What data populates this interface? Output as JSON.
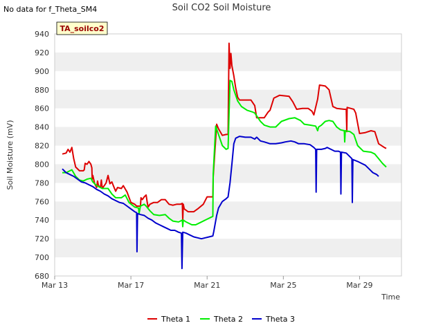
{
  "no_data_note": "No data for f_Theta_SM4",
  "site_tag": "TA_soilco2",
  "colors": {
    "theta1": "#dd0000",
    "theta2": "#00ee00",
    "theta3": "#0000cc",
    "band": "#efefef",
    "tag_bg": "#ffffcc"
  },
  "chart_data": {
    "type": "line",
    "title": "Soil CO2 Soil Moisture",
    "xlabel": "Time",
    "ylabel": "Soil Moisture (mV)",
    "xlim": [
      0,
      18.2
    ],
    "ylim": [
      680,
      940
    ],
    "x_ticks": [
      {
        "x": 0,
        "label": "Mar 13"
      },
      {
        "x": 4,
        "label": "Mar 17"
      },
      {
        "x": 8,
        "label": "Mar 21"
      },
      {
        "x": 12,
        "label": "Mar 25"
      },
      {
        "x": 16,
        "label": "Mar 29"
      }
    ],
    "y_ticks": [
      680,
      700,
      720,
      740,
      760,
      780,
      800,
      820,
      840,
      860,
      880,
      900,
      920,
      940
    ],
    "grid": "horizontal alternating bands",
    "legend_position": "bottom",
    "series": [
      {
        "name": "Theta 1",
        "color": "#dd0000",
        "points": [
          [
            0.4,
            811
          ],
          [
            0.6,
            812
          ],
          [
            0.7,
            816
          ],
          [
            0.8,
            813
          ],
          [
            0.9,
            818
          ],
          [
            1.0,
            806
          ],
          [
            1.1,
            797
          ],
          [
            1.3,
            793
          ],
          [
            1.5,
            793
          ],
          [
            1.55,
            794
          ],
          [
            1.6,
            801
          ],
          [
            1.7,
            800
          ],
          [
            1.8,
            803
          ],
          [
            1.9,
            800
          ],
          [
            1.95,
            796
          ],
          [
            1.97,
            784
          ],
          [
            2.0,
            788
          ],
          [
            2.1,
            779
          ],
          [
            2.2,
            775
          ],
          [
            2.25,
            782
          ],
          [
            2.3,
            777
          ],
          [
            2.4,
            775
          ],
          [
            2.45,
            783
          ],
          [
            2.5,
            774
          ],
          [
            2.7,
            780
          ],
          [
            2.8,
            788
          ],
          [
            2.9,
            779
          ],
          [
            3.0,
            781
          ],
          [
            3.1,
            776
          ],
          [
            3.2,
            771
          ],
          [
            3.3,
            775
          ],
          [
            3.5,
            774
          ],
          [
            3.6,
            777
          ],
          [
            3.8,
            770
          ],
          [
            4.0,
            759
          ],
          [
            4.2,
            757
          ],
          [
            4.3,
            755
          ],
          [
            4.5,
            755
          ],
          [
            4.53,
            764
          ],
          [
            4.6,
            762
          ],
          [
            4.7,
            765
          ],
          [
            4.8,
            767
          ],
          [
            4.85,
            760
          ],
          [
            4.9,
            754
          ],
          [
            5.0,
            757
          ],
          [
            5.2,
            759
          ],
          [
            5.4,
            759
          ],
          [
            5.6,
            762
          ],
          [
            5.8,
            762
          ],
          [
            6.0,
            757
          ],
          [
            6.2,
            756
          ],
          [
            6.4,
            757
          ],
          [
            6.6,
            757
          ],
          [
            6.7,
            758
          ],
          [
            6.72,
            739
          ],
          [
            6.75,
            757
          ],
          [
            6.8,
            752
          ],
          [
            7.0,
            749
          ],
          [
            7.3,
            749
          ],
          [
            7.5,
            752
          ],
          [
            7.8,
            757
          ],
          [
            8.0,
            765
          ],
          [
            8.3,
            765
          ],
          [
            8.32,
            786
          ],
          [
            8.5,
            843
          ],
          [
            8.6,
            838
          ],
          [
            8.8,
            831
          ],
          [
            9.0,
            832
          ],
          [
            9.1,
            832
          ],
          [
            9.15,
            930
          ],
          [
            9.2,
            903
          ],
          [
            9.25,
            919
          ],
          [
            9.3,
            906
          ],
          [
            9.4,
            895
          ],
          [
            9.5,
            882
          ],
          [
            9.6,
            872
          ],
          [
            9.7,
            869
          ],
          [
            10.0,
            869
          ],
          [
            10.3,
            869
          ],
          [
            10.5,
            863
          ],
          [
            10.6,
            850
          ],
          [
            11.0,
            850
          ],
          [
            11.2,
            856
          ],
          [
            11.3,
            858
          ],
          [
            11.5,
            871
          ],
          [
            11.8,
            874
          ],
          [
            12.3,
            873
          ],
          [
            12.5,
            867
          ],
          [
            12.7,
            859
          ],
          [
            13.0,
            860
          ],
          [
            13.3,
            860
          ],
          [
            13.5,
            857
          ],
          [
            13.6,
            853
          ],
          [
            13.8,
            870
          ],
          [
            13.9,
            885
          ],
          [
            14.2,
            884
          ],
          [
            14.4,
            880
          ],
          [
            14.6,
            862
          ],
          [
            14.8,
            860
          ],
          [
            15.2,
            859
          ],
          [
            15.3,
            859
          ],
          [
            15.33,
            835
          ],
          [
            15.35,
            861
          ],
          [
            15.7,
            859
          ],
          [
            15.8,
            855
          ],
          [
            16.0,
            833
          ],
          [
            16.3,
            834
          ],
          [
            16.6,
            836
          ],
          [
            16.8,
            835
          ],
          [
            17.0,
            822
          ],
          [
            17.3,
            818
          ],
          [
            17.4,
            817
          ]
        ]
      },
      {
        "name": "Theta 2",
        "color": "#00ee00",
        "points": [
          [
            0.4,
            791
          ],
          [
            0.6,
            791
          ],
          [
            0.8,
            793
          ],
          [
            0.9,
            794
          ],
          [
            1.1,
            787
          ],
          [
            1.3,
            783
          ],
          [
            1.5,
            782
          ],
          [
            1.7,
            784
          ],
          [
            1.9,
            785
          ],
          [
            2.0,
            781
          ],
          [
            2.2,
            777
          ],
          [
            2.5,
            774
          ],
          [
            2.8,
            774
          ],
          [
            3.0,
            768
          ],
          [
            3.2,
            764
          ],
          [
            3.5,
            764
          ],
          [
            3.7,
            767
          ],
          [
            3.9,
            759
          ],
          [
            4.2,
            754
          ],
          [
            4.4,
            753
          ],
          [
            4.43,
            747
          ],
          [
            4.5,
            755
          ],
          [
            4.7,
            757
          ],
          [
            4.8,
            755
          ],
          [
            5.0,
            750
          ],
          [
            5.2,
            746
          ],
          [
            5.5,
            745
          ],
          [
            5.8,
            746
          ],
          [
            6.0,
            742
          ],
          [
            6.2,
            739
          ],
          [
            6.5,
            738
          ],
          [
            6.6,
            739
          ],
          [
            6.7,
            740
          ],
          [
            6.72,
            733
          ],
          [
            6.75,
            740
          ],
          [
            6.9,
            738
          ],
          [
            7.2,
            735
          ],
          [
            7.4,
            735
          ],
          [
            7.6,
            737
          ],
          [
            8.0,
            741
          ],
          [
            8.3,
            744
          ],
          [
            8.32,
            789
          ],
          [
            8.45,
            841
          ],
          [
            8.6,
            832
          ],
          [
            8.8,
            820
          ],
          [
            9.0,
            816
          ],
          [
            9.1,
            817
          ],
          [
            9.2,
            890
          ],
          [
            9.3,
            889
          ],
          [
            9.4,
            880
          ],
          [
            9.6,
            868
          ],
          [
            9.8,
            862
          ],
          [
            10.1,
            858
          ],
          [
            10.4,
            856
          ],
          [
            10.5,
            855
          ],
          [
            10.8,
            846
          ],
          [
            11.0,
            842
          ],
          [
            11.3,
            840
          ],
          [
            11.6,
            840
          ],
          [
            11.9,
            846
          ],
          [
            12.3,
            849
          ],
          [
            12.6,
            850
          ],
          [
            12.9,
            847
          ],
          [
            13.1,
            843
          ],
          [
            13.4,
            842
          ],
          [
            13.7,
            841
          ],
          [
            13.8,
            836
          ],
          [
            13.85,
            840
          ],
          [
            14.0,
            842
          ],
          [
            14.2,
            846
          ],
          [
            14.4,
            847
          ],
          [
            14.6,
            846
          ],
          [
            14.8,
            840
          ],
          [
            15.0,
            837
          ],
          [
            15.2,
            836
          ],
          [
            15.22,
            824
          ],
          [
            15.25,
            836
          ],
          [
            15.5,
            835
          ],
          [
            15.7,
            832
          ],
          [
            15.9,
            820
          ],
          [
            16.2,
            814
          ],
          [
            16.6,
            813
          ],
          [
            16.8,
            811
          ],
          [
            17.0,
            806
          ],
          [
            17.2,
            801
          ],
          [
            17.4,
            797
          ]
        ]
      },
      {
        "name": "Theta 3",
        "color": "#0000cc",
        "points": [
          [
            0.4,
            795
          ],
          [
            0.6,
            791
          ],
          [
            0.8,
            789
          ],
          [
            1.0,
            787
          ],
          [
            1.2,
            784
          ],
          [
            1.4,
            781
          ],
          [
            1.6,
            780
          ],
          [
            1.8,
            778
          ],
          [
            2.0,
            776
          ],
          [
            2.2,
            773
          ],
          [
            2.4,
            771
          ],
          [
            2.6,
            768
          ],
          [
            2.8,
            766
          ],
          [
            3.0,
            763
          ],
          [
            3.2,
            761
          ],
          [
            3.4,
            759
          ],
          [
            3.6,
            758
          ],
          [
            3.8,
            755
          ],
          [
            4.0,
            752
          ],
          [
            4.2,
            749
          ],
          [
            4.3,
            748
          ],
          [
            4.32,
            706
          ],
          [
            4.35,
            747
          ],
          [
            4.5,
            746
          ],
          [
            4.7,
            745
          ],
          [
            4.9,
            742
          ],
          [
            5.1,
            740
          ],
          [
            5.3,
            737
          ],
          [
            5.5,
            735
          ],
          [
            5.7,
            733
          ],
          [
            5.9,
            731
          ],
          [
            6.1,
            729
          ],
          [
            6.3,
            729
          ],
          [
            6.5,
            727
          ],
          [
            6.65,
            726
          ],
          [
            6.68,
            688
          ],
          [
            6.72,
            727
          ],
          [
            6.9,
            726
          ],
          [
            7.1,
            724
          ],
          [
            7.3,
            722
          ],
          [
            7.5,
            721
          ],
          [
            7.7,
            720
          ],
          [
            7.9,
            721
          ],
          [
            8.1,
            722
          ],
          [
            8.3,
            723
          ],
          [
            8.35,
            728
          ],
          [
            8.5,
            745
          ],
          [
            8.6,
            753
          ],
          [
            8.8,
            760
          ],
          [
            9.0,
            763
          ],
          [
            9.1,
            765
          ],
          [
            9.2,
            780
          ],
          [
            9.3,
            800
          ],
          [
            9.4,
            822
          ],
          [
            9.5,
            828
          ],
          [
            9.7,
            830
          ],
          [
            10.0,
            829
          ],
          [
            10.3,
            829
          ],
          [
            10.5,
            827
          ],
          [
            10.6,
            829
          ],
          [
            10.8,
            825
          ],
          [
            11.0,
            824
          ],
          [
            11.3,
            822
          ],
          [
            11.6,
            822
          ],
          [
            11.9,
            823
          ],
          [
            12.1,
            824
          ],
          [
            12.4,
            825
          ],
          [
            12.6,
            824
          ],
          [
            12.8,
            822
          ],
          [
            13.1,
            822
          ],
          [
            13.4,
            821
          ],
          [
            13.6,
            818
          ],
          [
            13.7,
            816
          ],
          [
            13.72,
            770
          ],
          [
            13.75,
            816
          ],
          [
            14.0,
            816
          ],
          [
            14.2,
            817
          ],
          [
            14.3,
            818
          ],
          [
            14.5,
            816
          ],
          [
            14.7,
            814
          ],
          [
            14.9,
            814
          ],
          [
            15.0,
            813
          ],
          [
            15.02,
            768
          ],
          [
            15.05,
            813
          ],
          [
            15.3,
            812
          ],
          [
            15.6,
            806
          ],
          [
            15.62,
            759
          ],
          [
            15.65,
            805
          ],
          [
            15.9,
            803
          ],
          [
            16.1,
            801
          ],
          [
            16.3,
            799
          ],
          [
            16.5,
            795
          ],
          [
            16.7,
            791
          ],
          [
            16.9,
            789
          ],
          [
            17.0,
            787
          ]
        ]
      }
    ]
  }
}
